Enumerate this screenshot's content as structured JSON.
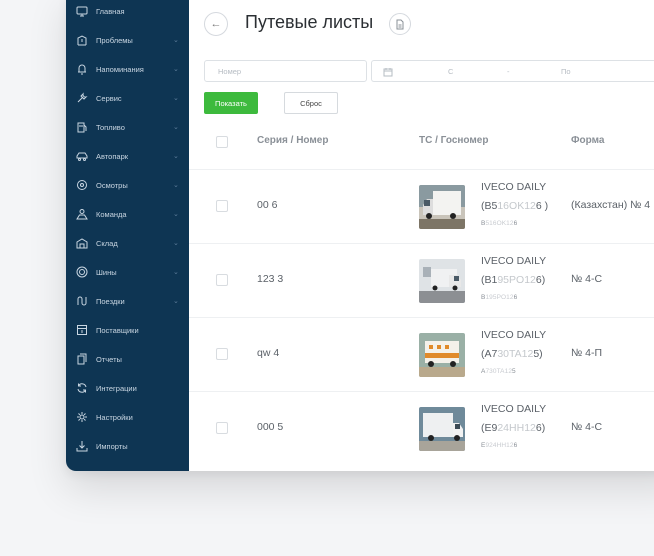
{
  "sidebar": {
    "items": [
      {
        "label": "Главная",
        "icon": "dashboard-icon",
        "chevron": false
      },
      {
        "label": "Проблемы",
        "icon": "warning-icon",
        "chevron": true
      },
      {
        "label": "Напоминания",
        "icon": "bell-icon",
        "chevron": true
      },
      {
        "label": "Сервис",
        "icon": "wrench-icon",
        "chevron": true
      },
      {
        "label": "Топливо",
        "icon": "fuel-icon",
        "chevron": true
      },
      {
        "label": "Автопарк",
        "icon": "car-icon",
        "chevron": true
      },
      {
        "label": "Осмотры",
        "icon": "inspection-icon",
        "chevron": true
      },
      {
        "label": "Команда",
        "icon": "team-icon",
        "chevron": true
      },
      {
        "label": "Склад",
        "icon": "warehouse-icon",
        "chevron": true
      },
      {
        "label": "Шины",
        "icon": "tire-icon",
        "chevron": true
      },
      {
        "label": "Поездки",
        "icon": "route-icon",
        "chevron": true
      },
      {
        "label": "Поставщики",
        "icon": "supplier-icon",
        "chevron": false
      },
      {
        "label": "Отчеты",
        "icon": "reports-icon",
        "chevron": false
      },
      {
        "label": "Интеграции",
        "icon": "integrations-icon",
        "chevron": false
      },
      {
        "label": "Настройки",
        "icon": "gear-icon",
        "chevron": false
      },
      {
        "label": "Импорты",
        "icon": "import-icon",
        "chevron": false
      }
    ],
    "chevron_glyph": "⌄"
  },
  "header": {
    "title": "Путевые листы",
    "back_glyph": "←"
  },
  "filters": {
    "number_placeholder": "Номер",
    "date_from_label": "С",
    "date_separator": "-",
    "date_to_label": "По",
    "show_label": "Показать",
    "reset_label": "Сброс"
  },
  "table": {
    "columns": [
      "Серия / Номер",
      "ТС / Госномер",
      "Форма"
    ],
    "rows": [
      {
        "series": "00 6",
        "vehicle": "IVECO DAILY",
        "plate_pre": "(B5",
        "plate_hl": "16OK12",
        "plate_post": "6 )",
        "small_pre": "B",
        "small_hl": "516OK12",
        "small_post": "6",
        "form": "(Казахстан) № 4",
        "thumb": "white-box-truck"
      },
      {
        "series": "123 3",
        "vehicle": "IVECO DAILY",
        "plate_pre": "(B1",
        "plate_hl": "95PO12",
        "plate_post": "6)",
        "small_pre": "B",
        "small_hl": "195PO12",
        "small_post": "6",
        "form": "№ 4-С",
        "thumb": "white-box-truck"
      },
      {
        "series": "qw 4",
        "vehicle": "IVECO DAILY",
        "plate_pre": "(A7",
        "plate_hl": "30TA12",
        "plate_post": "5)",
        "small_pre": "A",
        "small_hl": "730TA12",
        "small_post": "5",
        "form": "№ 4-П",
        "thumb": "orange-striped-truck"
      },
      {
        "series": "000 5",
        "vehicle": "IVECO DAILY",
        "plate_pre": "(E9",
        "plate_hl": "24HH12",
        "plate_post": "6)",
        "small_pre": "E",
        "small_hl": "924HH12",
        "small_post": "6",
        "form": "№ 4-С",
        "thumb": "white-box-truck"
      }
    ]
  },
  "colors": {
    "sidebar_bg": "#0e3553",
    "accent_green": "#3dba3d"
  }
}
